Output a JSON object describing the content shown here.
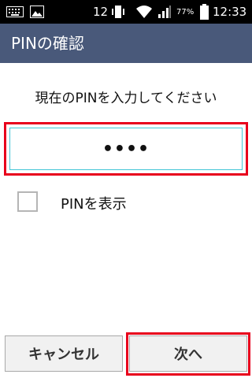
{
  "status_bar": {
    "notification_count": "12",
    "battery_percent": "77%",
    "time": "12:33",
    "icons": [
      "keyboard-icon",
      "image-icon",
      "vibrate-icon",
      "wifi-icon",
      "signal-icon",
      "battery-icon"
    ]
  },
  "app_bar": {
    "title": "PINの確認"
  },
  "prompt": "現在のPINを入力してください",
  "pin_field": {
    "value": "••••"
  },
  "show_pin": {
    "label": "PINを表示",
    "checked": false
  },
  "buttons": {
    "cancel": "キャンセル",
    "next": "次へ"
  },
  "colors": {
    "app_bar": "#49597a",
    "field_border": "#43c6d6",
    "highlight": "#e8001c",
    "button_bg": "#f1f1f1"
  }
}
